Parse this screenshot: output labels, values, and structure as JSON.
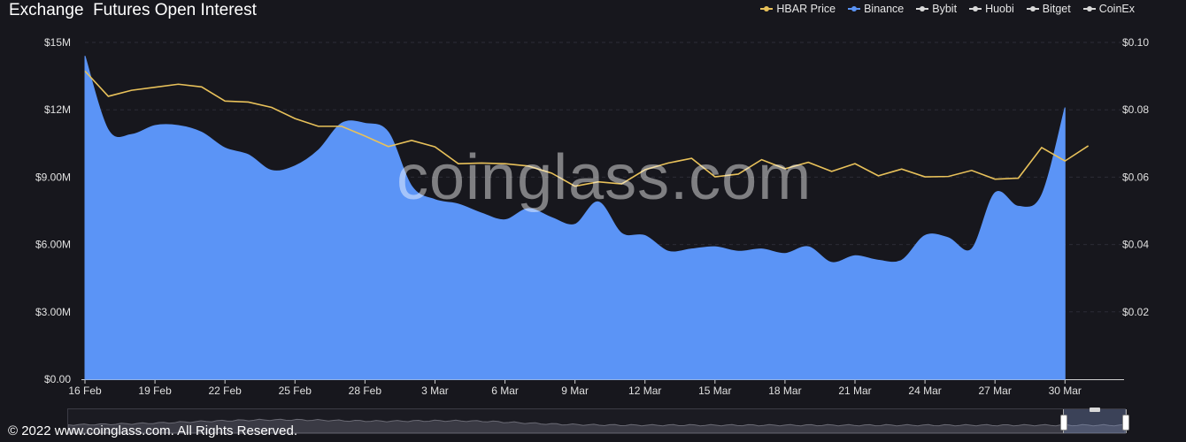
{
  "chart_data": {
    "type": "area",
    "title": "Exchange  Futures Open Interest",
    "x": [
      "16 Feb",
      "17 Feb",
      "18 Feb",
      "19 Feb",
      "20 Feb",
      "21 Feb",
      "22 Feb",
      "23 Feb",
      "24 Feb",
      "25 Feb",
      "26 Feb",
      "27 Feb",
      "28 Feb",
      "1 Mar",
      "2 Mar",
      "3 Mar",
      "4 Mar",
      "5 Mar",
      "6 Mar",
      "7 Mar",
      "8 Mar",
      "9 Mar",
      "10 Mar",
      "11 Mar",
      "12 Mar",
      "13 Mar",
      "14 Mar",
      "15 Mar",
      "16 Mar",
      "17 Mar",
      "18 Mar",
      "19 Mar",
      "20 Mar",
      "21 Mar",
      "22 Mar",
      "23 Mar",
      "24 Mar",
      "25 Mar",
      "26 Mar",
      "27 Mar",
      "28 Mar",
      "29 Mar",
      "30 Mar",
      "31 Mar",
      "1 Apr"
    ],
    "x_ticks": [
      "16 Feb",
      "19 Feb",
      "22 Feb",
      "25 Feb",
      "28 Feb",
      "3 Mar",
      "6 Mar",
      "9 Mar",
      "12 Mar",
      "15 Mar",
      "18 Mar",
      "21 Mar",
      "24 Mar",
      "27 Mar",
      "30 Mar"
    ],
    "y_left": {
      "range": [
        0,
        15000000
      ],
      "ticks": [
        "$0.00",
        "$3.00M",
        "$6.00M",
        "$9.00M",
        "$12M",
        "$15M"
      ]
    },
    "y_right": {
      "range": [
        0,
        0.1
      ],
      "ticks": [
        "$0.02",
        "$0.04",
        "$0.06",
        "$0.08",
        "$0.10"
      ]
    },
    "grid": "horizontal dashed",
    "legend_placement": "top-right",
    "series": [
      {
        "name": "HBAR Price",
        "axis": "right",
        "type": "line",
        "color": "#e8c15a",
        "values": [
          0.0915,
          0.084,
          0.0858,
          0.0867,
          0.0876,
          0.0868,
          0.0826,
          0.0823,
          0.0807,
          0.0774,
          0.0751,
          0.0751,
          0.0722,
          0.0691,
          0.0709,
          0.069,
          0.064,
          0.0642,
          0.064,
          0.0633,
          0.0612,
          0.0573,
          0.0586,
          0.058,
          0.0622,
          0.0642,
          0.0656,
          0.0601,
          0.0609,
          0.0652,
          0.0625,
          0.0644,
          0.0617,
          0.064,
          0.0604,
          0.0624,
          0.0601,
          0.0602,
          0.062,
          0.0594,
          0.0597,
          0.0688,
          0.0648,
          0.0693
        ]
      },
      {
        "name": "Binance",
        "axis": "left",
        "type": "area",
        "color": "#5b94f6",
        "values": [
          14400000,
          11100000,
          10900000,
          11300000,
          11300000,
          11000000,
          10300000,
          10000000,
          9300000,
          9500000,
          10200000,
          11400000,
          11400000,
          11000000,
          8600000,
          8000000,
          7800000,
          7400000,
          7100000,
          7600000,
          7200000,
          6900000,
          7900000,
          6500000,
          6400000,
          5700000,
          5800000,
          5900000,
          5700000,
          5800000,
          5600000,
          5900000,
          5200000,
          5500000,
          5300000,
          5300000,
          6400000,
          6300000,
          5800000,
          8300000,
          7700000,
          8200000,
          12100000
        ]
      },
      {
        "name": "Bybit",
        "axis": "left",
        "type": "area",
        "color": "#d9d9d9",
        "values": []
      },
      {
        "name": "Huobi",
        "axis": "left",
        "type": "area",
        "color": "#d9d9d9",
        "values": []
      },
      {
        "name": "Bitget",
        "axis": "left",
        "type": "area",
        "color": "#d9d9d9",
        "values": []
      },
      {
        "name": "CoinEx",
        "axis": "left",
        "type": "area",
        "color": "#d9d9d9",
        "values": []
      }
    ]
  },
  "watermark": "coinglass.com",
  "footer": "© 2022 www.coinglass.com. All Rights Reserved."
}
